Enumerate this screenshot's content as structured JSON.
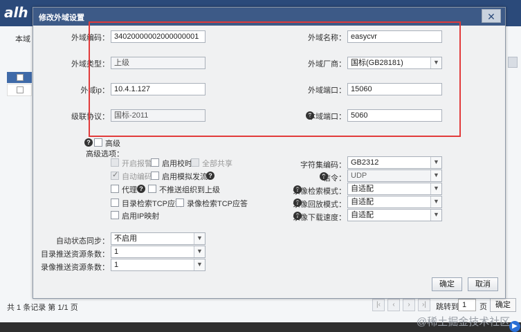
{
  "app": {
    "logo": "alh",
    "tab_label": "本域",
    "records_text": "共 1 条记录 第 1/1 页"
  },
  "pager": {
    "goto_label": "跳转到",
    "page_value": "1",
    "page_unit": "页",
    "confirm_label": "确定"
  },
  "watermark": "@稀土掘金技术社区",
  "dialog": {
    "title": "修改外域设置",
    "close_glyph": "✕",
    "fields": {
      "ext_code_label": "外域编码：",
      "ext_code_value": "34020000002000000001",
      "ext_name_label": "外域名称：",
      "ext_name_value": "easycvr",
      "ext_type_label": "外域类型：",
      "ext_type_value": "上级",
      "ext_vendor_label": "外域厂商：",
      "ext_vendor_value": "国标(GB28181)",
      "ext_ip_label": "外域ip：",
      "ext_ip_value": "10.4.1.127",
      "ext_port_label": "外域端口：",
      "ext_port_value": "15060",
      "cascade_label": "级联协议：",
      "cascade_value": "国标-2011",
      "local_port_label": "本域端口：",
      "local_port_value": "5060"
    },
    "senior_label": "高级",
    "adv_label": "高级选项：",
    "options": {
      "open_alarm": "开启报警",
      "enable_timing": "启用校时",
      "all_share": "全部共享",
      "auto_code": "自动编码",
      "simulate_ip": "启用模拟发流IP",
      "proxy": "代理",
      "no_push_org": "不推送组织到上级",
      "dir_tcp": "目录检索TCP应答",
      "rec_tcp": "录像检索TCP应答",
      "ip_map": "启用IP映射"
    },
    "right_selects": {
      "charset_label": "字符集编码：",
      "charset_value": "GB2312",
      "signal_label": "信令：",
      "signal_value": "UDP",
      "rec_search_label": "录像检索模式：",
      "rec_search_value": "自适配",
      "rec_play_label": "录像回放模式：",
      "rec_play_value": "自适配",
      "rec_dl_label": "录像下载速度：",
      "rec_dl_value": "自适配"
    },
    "bottom_selects": {
      "auto_sync_label": "自动状态同步：",
      "auto_sync_value": "不启用",
      "dir_push_label": "目录推送资源条数：",
      "dir_push_value": "1",
      "rec_push_label": "录像推送资源条数：",
      "rec_push_value": "1"
    },
    "ok_label": "确定",
    "cancel_label": "取消"
  },
  "colors": {
    "title_bar": "#3d5a87",
    "highlight": "#e23a3a"
  },
  "icons": {
    "help": "question-circle-icon",
    "arrow": "chevron-down-icon"
  }
}
